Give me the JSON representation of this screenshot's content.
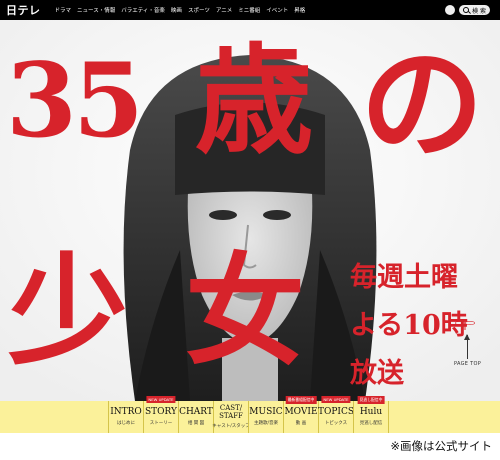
{
  "header": {
    "logo": "日テレ",
    "nav": [
      "ドラマ",
      "ニュース・情報",
      "バラエティ・音楽",
      "映画",
      "スポーツ",
      "アニメ",
      "ミニ番組",
      "イベント",
      "昇格"
    ],
    "search_label": "検 索"
  },
  "hero": {
    "title_35": "35",
    "title_sai": "歳",
    "title_no": "の",
    "title_shou": "少",
    "title_jo": "女",
    "schedule": [
      "毎週土曜",
      "よる10時",
      "放送"
    ],
    "pagetop": "PAGE TOP"
  },
  "menu": {
    "items": [
      {
        "label": "INTRO",
        "sub": "はじめに",
        "badge": ""
      },
      {
        "label": "STORY",
        "sub": "ストーリー",
        "badge": "NEW UPDATE"
      },
      {
        "label": "CHART",
        "sub": "相 関 図",
        "badge": ""
      },
      {
        "label": "CAST/\nSTAFF",
        "sub": "キャスト/スタッフ",
        "badge": ""
      },
      {
        "label": "MUSIC",
        "sub": "主題歌/音楽",
        "badge": ""
      },
      {
        "label": "MOVIE",
        "sub": "動 画",
        "badge": "最新番組配信中"
      },
      {
        "label": "TOPICS",
        "sub": "トピックス",
        "badge": "NEW UPDATE"
      },
      {
        "label": "Hulu",
        "sub": "見逃し配信",
        "badge": "見逃し配信中"
      }
    ]
  },
  "caption": "※画像は公式サイト",
  "colors": {
    "accent_red": "#d7232b",
    "menu_bg": "#fbf19a",
    "topbar": "#000000"
  }
}
